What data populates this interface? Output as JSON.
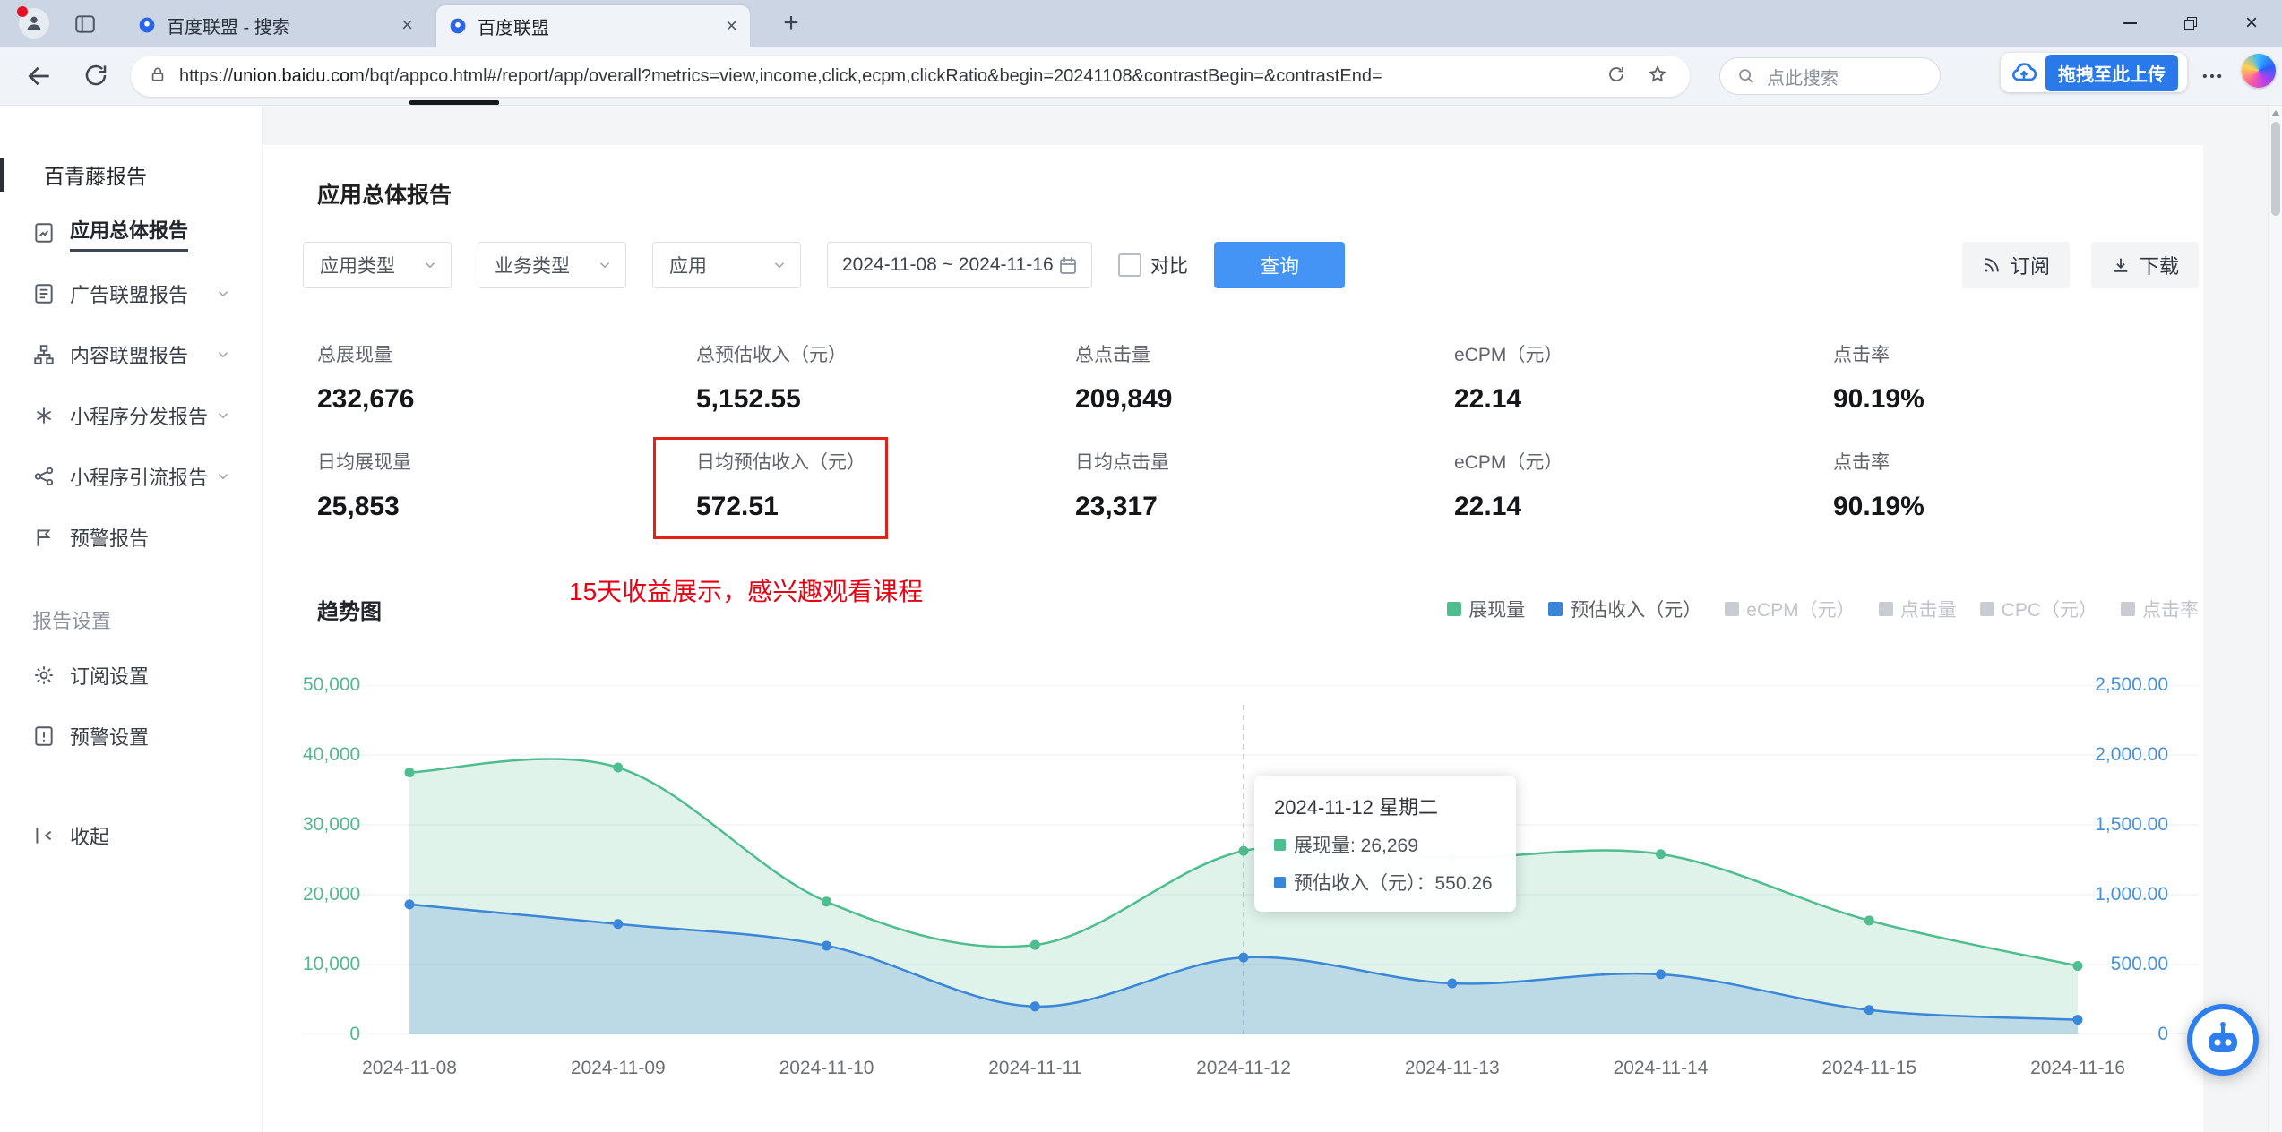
{
  "browser": {
    "tab1": "百度联盟 - 搜索",
    "tab2": "百度联盟",
    "url_scheme": "https://",
    "url_host": "union.baidu.com",
    "url_path": "/bqt/appco.html#/report/app/overall?metrics=view,income,click,ecpm,clickRatio&begin=20241108&contrastBegin=&contrastEnd=",
    "search_placeholder": "点此搜索",
    "upload_label": "拖拽至此上传"
  },
  "sidebar": {
    "report_section": "百青藤报告",
    "items": [
      {
        "label": "应用总体报告"
      },
      {
        "label": "广告联盟报告"
      },
      {
        "label": "内容联盟报告"
      },
      {
        "label": "小程序分发报告"
      },
      {
        "label": "小程序引流报告"
      },
      {
        "label": "预警报告"
      }
    ],
    "settings_section": "报告设置",
    "settings": [
      {
        "label": "订阅设置"
      },
      {
        "label": "预警设置"
      }
    ],
    "collapse": "收起"
  },
  "main": {
    "title": "应用总体报告",
    "filters": {
      "app_type": "应用类型",
      "business_type": "业务类型",
      "app": "应用",
      "date_range": "2024-11-08 ~ 2024-11-16",
      "compare_label": "对比",
      "query_button": "查询",
      "subscribe_button": "订阅",
      "download_button": "下载"
    },
    "stats_row1": [
      {
        "label": "总展现量",
        "value": "232,676"
      },
      {
        "label": "总预估收入（元）",
        "value": "5,152.55"
      },
      {
        "label": "总点击量",
        "value": "209,849"
      },
      {
        "label": "eCPM（元）",
        "value": "22.14"
      },
      {
        "label": "点击率",
        "value": "90.19%"
      }
    ],
    "stats_row2": [
      {
        "label": "日均展现量",
        "value": "25,853"
      },
      {
        "label": "日均预估收入（元）",
        "value": "572.51"
      },
      {
        "label": "日均点击量",
        "value": "23,317"
      },
      {
        "label": "eCPM（元）",
        "value": "22.14"
      },
      {
        "label": "点击率",
        "value": "90.19%"
      }
    ],
    "annotation": "15天收益展示，感兴趣观看课程",
    "trend_title": "趋势图"
  },
  "chart_data": {
    "type": "area",
    "title": "趋势图",
    "x": [
      "2024-11-08",
      "2024-11-09",
      "2024-11-10",
      "2024-11-11",
      "2024-11-12",
      "2024-11-13",
      "2024-11-14",
      "2024-11-15",
      "2024-11-16"
    ],
    "series": [
      {
        "name": "展现量",
        "axis": "left",
        "color": "#4fbe8e",
        "values": [
          37500,
          38200,
          19000,
          12800,
          26269,
          25300,
          25800,
          16300,
          9800
        ]
      },
      {
        "name": "预估收入（元）",
        "axis": "right",
        "color": "#3a86d8",
        "values": [
          930,
          790,
          635,
          200,
          550.26,
          365,
          430,
          175,
          105
        ]
      }
    ],
    "left_axis": {
      "range": [
        0,
        50000
      ],
      "ticks": [
        "0",
        "10,000",
        "20,000",
        "30,000",
        "40,000",
        "50,000"
      ]
    },
    "right_axis": {
      "range": [
        0,
        2500
      ],
      "ticks": [
        "0",
        "500.00",
        "1,000.00",
        "1,500.00",
        "2,000.00",
        "2,500.00"
      ]
    },
    "grid": true,
    "legend_position": "top-right",
    "legend": [
      {
        "label": "展现量",
        "color": "#4fbe8e",
        "active": true
      },
      {
        "label": "预估收入（元）",
        "color": "#3a86d8",
        "active": true
      },
      {
        "label": "eCPM（元）",
        "color": "#c8cdd4",
        "active": false
      },
      {
        "label": "点击量",
        "color": "#c8cdd4",
        "active": false
      },
      {
        "label": "CPC（元）",
        "color": "#c8cdd4",
        "active": false
      },
      {
        "label": "点击率",
        "color": "#c8cdd4",
        "active": false
      }
    ],
    "highlight_index": 4,
    "tooltip": {
      "title": "2024-11-12 星期二",
      "rows": [
        {
          "label": "展现量",
          "sep": ": ",
          "value": "26,269",
          "color": "#4fbe8e"
        },
        {
          "label": "预估收入（元）",
          "sep": "：",
          "value": "550.26",
          "color": "#3a86d8"
        }
      ]
    }
  }
}
